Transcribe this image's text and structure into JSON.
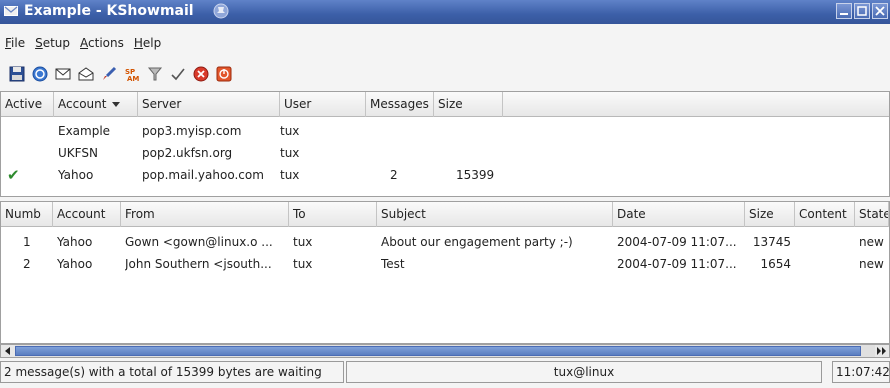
{
  "window": {
    "title": "Example - KShowmail",
    "icons": {
      "app": "kshowmail-icon",
      "sticky": "sticky-pin-icon",
      "minimize": "minimize-icon",
      "maximize": "maximize-icon",
      "close": "close-icon"
    }
  },
  "menu": {
    "items": [
      {
        "label": "File",
        "mnemonic": "F",
        "rest": "ile"
      },
      {
        "label": "Setup",
        "mnemonic": "S",
        "rest": "etup"
      },
      {
        "label": "Actions",
        "mnemonic": "A",
        "rest": "ctions"
      },
      {
        "label": "Help",
        "mnemonic": "H",
        "rest": "elp"
      }
    ]
  },
  "toolbar": {
    "icons": [
      "save-icon",
      "refresh-icon",
      "mail-icon",
      "mail-open-icon",
      "brush-icon",
      "spam-icon",
      "filter-icon",
      "checkmark-icon",
      "stop-icon",
      "exit-icon"
    ]
  },
  "accounts": {
    "columns": [
      "Active",
      "Account",
      "Server",
      "User",
      "Messages",
      "Size"
    ],
    "rows": [
      {
        "active": "",
        "account": "Example",
        "server": "pop3.myisp.com",
        "user": "tux",
        "messages": "",
        "size": ""
      },
      {
        "active": "",
        "account": "UKFSN",
        "server": "pop2.ukfsn.org",
        "user": "tux",
        "messages": "",
        "size": ""
      },
      {
        "active": "✔",
        "account": "Yahoo",
        "server": "pop.mail.yahoo.com",
        "user": "tux",
        "messages": "2",
        "size": "15399"
      }
    ]
  },
  "messages": {
    "columns": [
      "Numb",
      "Account",
      "From",
      "To",
      "Subject",
      "Date",
      "Size",
      "Content",
      "State"
    ],
    "rows": [
      {
        "num": "1",
        "account": "Yahoo",
        "from": "Gown <gown@linux.o ...",
        "to": "tux",
        "subject": "About our engagement party ;-)",
        "date": "2004-07-09 11:07...",
        "size": "13745",
        "content": "",
        "state": "new"
      },
      {
        "num": "2",
        "account": "Yahoo",
        "from": "John Southern <jsouth...",
        "to": "tux",
        "subject": "Test",
        "date": "2004-07-09 11:07...",
        "size": "1654",
        "content": "",
        "state": "new"
      }
    ]
  },
  "statusbar": {
    "message": "2 message(s) with a total of 15399 bytes are waiting",
    "user": "tux@linux",
    "time": "11:07:42"
  },
  "colors": {
    "titlebar": "#3c5fa8",
    "checkmark": "#2e8b2e",
    "scroll_thumb": "#5a7ec0"
  }
}
